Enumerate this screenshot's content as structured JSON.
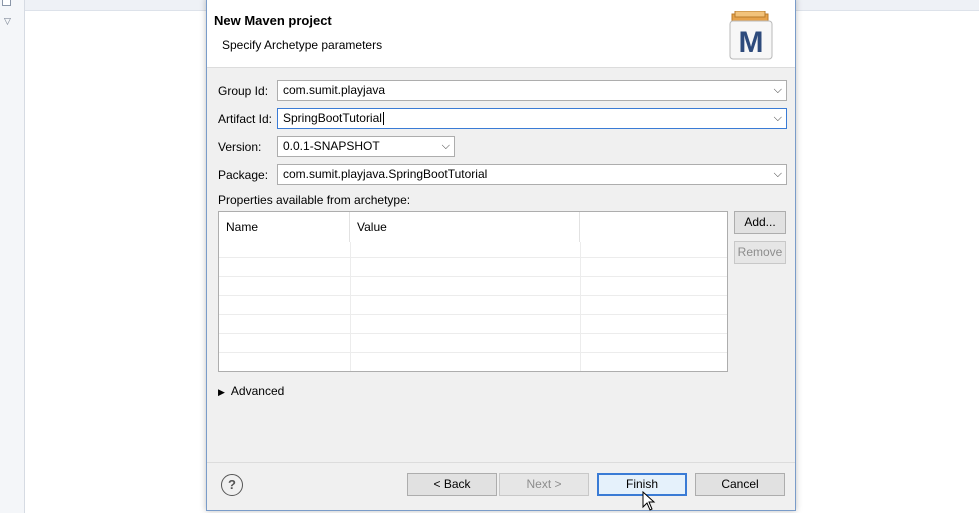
{
  "dialog": {
    "title": "New Maven project",
    "subtitle": "Specify Archetype parameters",
    "icon": "maven-m-icon"
  },
  "form": {
    "group_id": {
      "label": "Group Id:",
      "value": "com.sumit.playjava"
    },
    "artifact_id": {
      "label": "Artifact Id:",
      "value": "SpringBootTutorial"
    },
    "version": {
      "label": "Version:",
      "value": "0.0.1-SNAPSHOT"
    },
    "package": {
      "label": "Package:",
      "value": "com.sumit.playjava.SpringBootTutorial"
    }
  },
  "properties": {
    "label": "Properties available from archetype:",
    "columns": [
      "Name",
      "Value"
    ],
    "rows": []
  },
  "side_buttons": {
    "add": "Add...",
    "remove": "Remove"
  },
  "advanced": {
    "label": "Advanced"
  },
  "footer": {
    "help": "?",
    "back": "< Back",
    "next": "Next >",
    "finish": "Finish",
    "cancel": "Cancel"
  },
  "colors": {
    "accent": "#3a7bd5",
    "dialog_bg": "#f0f0f0",
    "maven_icon": "#2e4b7c"
  }
}
